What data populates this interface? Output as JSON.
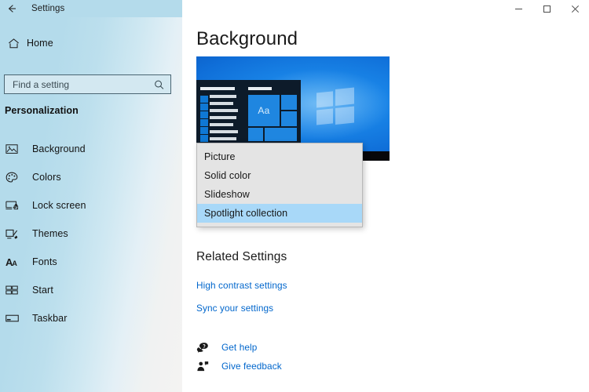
{
  "window": {
    "title": "Settings",
    "back_icon": "back-arrow-icon",
    "minimize_label": "Minimize",
    "maximize_label": "Maximize",
    "close_label": "Close"
  },
  "sidebar": {
    "home_label": "Home",
    "home_icon": "home-icon",
    "search": {
      "placeholder": "Find a setting",
      "value": "",
      "icon": "search-icon"
    },
    "section_title": "Personalization",
    "items": [
      {
        "label": "Background",
        "icon": "picture-icon",
        "selected": true
      },
      {
        "label": "Colors",
        "icon": "palette-icon",
        "selected": false
      },
      {
        "label": "Lock screen",
        "icon": "lock-screen-icon",
        "selected": false
      },
      {
        "label": "Themes",
        "icon": "brush-icon",
        "selected": false
      },
      {
        "label": "Fonts",
        "icon": "fonts-icon",
        "selected": false
      },
      {
        "label": "Start",
        "icon": "start-icon",
        "selected": false
      },
      {
        "label": "Taskbar",
        "icon": "taskbar-icon",
        "selected": false
      }
    ]
  },
  "main": {
    "page_title": "Background",
    "preview": {
      "name": "desktop-preview",
      "tile_text": "Aa",
      "wallpaper_color": "#0f6ed8",
      "taskbar_color": "#07070a"
    },
    "background_dropdown": {
      "open": true,
      "selected": "Spotlight collection",
      "options": [
        {
          "label": "Picture",
          "selected": false
        },
        {
          "label": "Solid color",
          "selected": false
        },
        {
          "label": "Slideshow",
          "selected": false
        },
        {
          "label": "Spotlight collection",
          "selected": true
        }
      ],
      "highlight_color": "#a8d8f8"
    },
    "related": {
      "title": "Related Settings",
      "links": [
        {
          "label": "High contrast settings"
        },
        {
          "label": "Sync your settings"
        }
      ],
      "link_color": "#0066cc"
    },
    "help": [
      {
        "label": "Get help",
        "icon": "help-bubble-icon"
      },
      {
        "label": "Give feedback",
        "icon": "feedback-person-icon"
      }
    ]
  }
}
